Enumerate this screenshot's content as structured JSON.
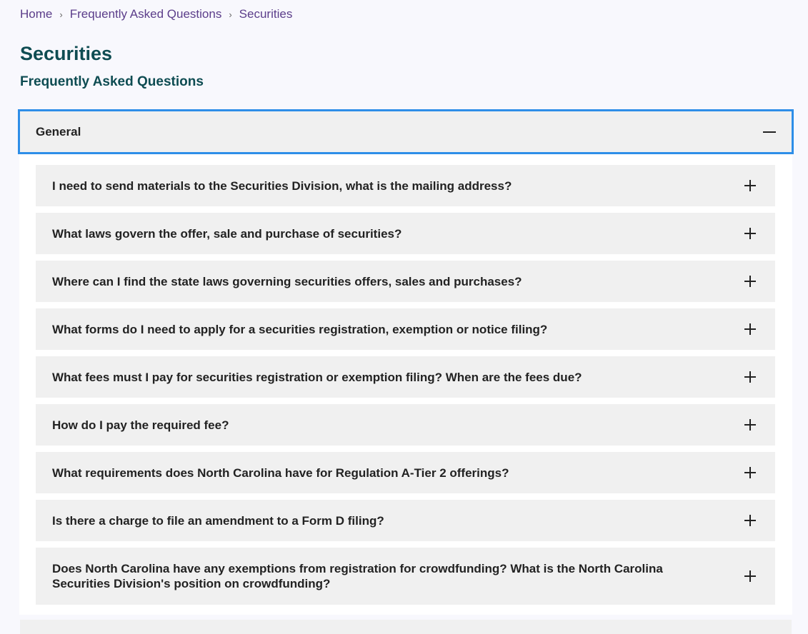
{
  "breadcrumb": {
    "items": [
      "Home",
      "Frequently Asked Questions"
    ],
    "current": "Securities",
    "separator": "›"
  },
  "page": {
    "title": "Securities",
    "subtitle": "Frequently Asked Questions"
  },
  "accordion": {
    "section_label": "General",
    "expanded": true,
    "questions": [
      "I need to send materials to the Securities Division, what is the mailing address?",
      "What laws govern the offer, sale and purchase of securities?",
      "Where can I find the state laws governing securities offers, sales and purchases?",
      "What forms do I need to apply for a securities registration, exemption or notice filing?",
      "What fees must I pay for securities registration or exemption filing? When are the fees due?",
      "How do I pay the required fee?",
      "What requirements does North Carolina have for Regulation A-Tier 2 offerings?",
      "Is there a charge to file an amendment to a Form D filing?",
      "Does North Carolina have any exemptions from registration for crowdfunding? What is the North Carolina Securities Division's position on crowdfunding?"
    ]
  },
  "colors": {
    "heading": "#0e4c52",
    "breadcrumb_link": "#5b3d8a",
    "focus_border": "#2e8ee8",
    "item_bg": "#f0f0f0"
  }
}
